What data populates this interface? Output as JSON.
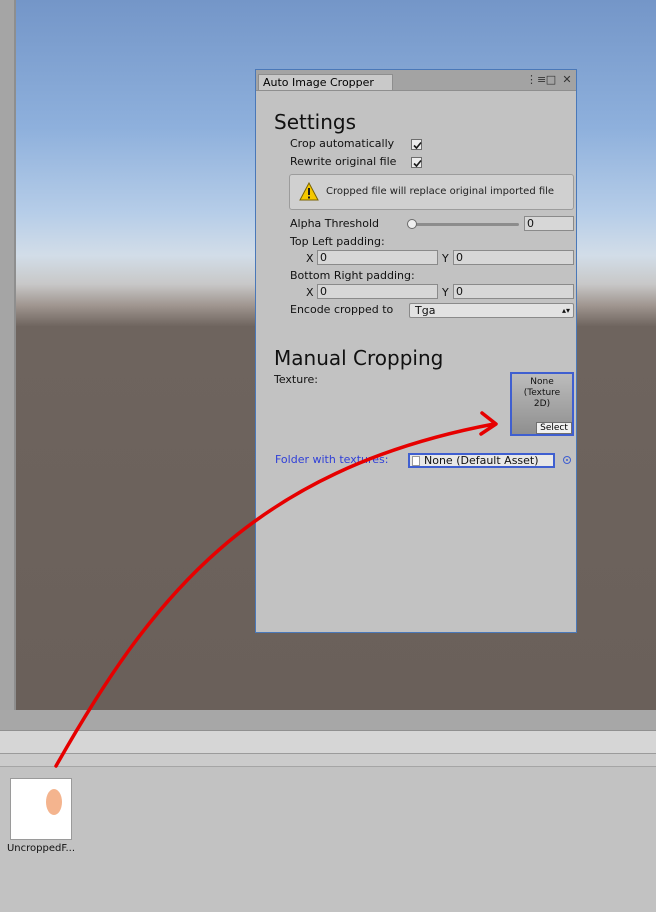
{
  "window": {
    "tab_title": "Auto Image Cropper",
    "menu_glyph": "⋮≡",
    "maximize_glyph": "□",
    "close_glyph": "✕"
  },
  "settings": {
    "title": "Settings",
    "crop_automatically": {
      "label": "Crop automatically",
      "checked": true
    },
    "rewrite_original": {
      "label": "Rewrite original file",
      "checked": true
    },
    "warning_message": "Cropped file will replace original imported file",
    "alpha_threshold": {
      "label": "Alpha Threshold",
      "value": "0"
    },
    "top_left_padding": {
      "label": "Top Left padding:",
      "x_label": "X",
      "x": "0",
      "y_label": "Y",
      "y": "0"
    },
    "bottom_right_padding": {
      "label": "Bottom Right padding:",
      "x_label": "X",
      "x": "0",
      "y_label": "Y",
      "y": "0"
    },
    "encode": {
      "label": "Encode cropped to",
      "value": "Tga",
      "arrow": "▴▾"
    }
  },
  "manual": {
    "title": "Manual Cropping",
    "texture_label": "Texture:",
    "texture_slot_text": "None\n(Texture\n2D)",
    "select_label": "Select",
    "folder_label": "Folder with textures:",
    "folder_value": "None (Default Asset)"
  },
  "project": {
    "asset_name": "UncroppedF..."
  },
  "colors": {
    "accent_blue": "#3f5fd0",
    "window_border": "#4a78b8",
    "folder_label": "#2f3fd8",
    "arrow_red": "#e60000",
    "warning_yellow": "#f5c800"
  }
}
